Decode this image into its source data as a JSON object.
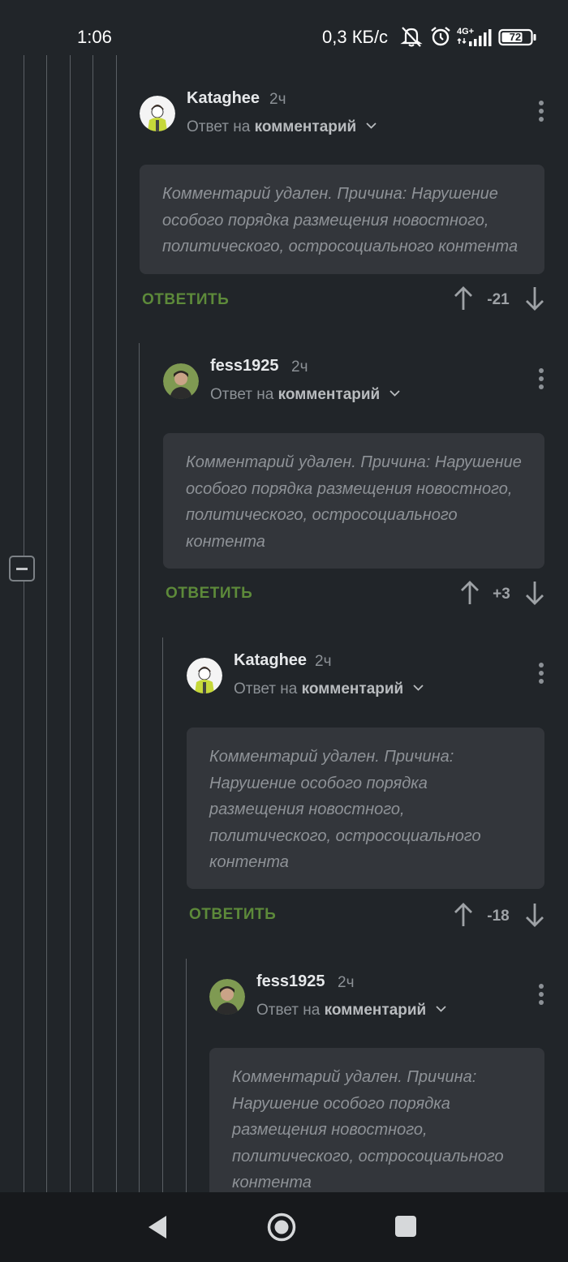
{
  "status_bar": {
    "time": "1:06",
    "net_speed": "0,3 КБ/с",
    "network_type": "4G+",
    "battery": "72",
    "icons": [
      "mute-icon",
      "alarm-icon",
      "signal-icon",
      "battery-icon"
    ]
  },
  "comments": [
    {
      "username": "Kataghee",
      "time": "2ч",
      "reply_prefix": "Ответ на",
      "reply_target": "комментарий",
      "text": "Комментарий удален. Причина: Нарушение особого порядка размещения новостного, политического, остросоциального контента",
      "reply_label": "ОТВЕТИТЬ",
      "score": "-21"
    },
    {
      "username": "fess1925",
      "time": "2ч",
      "reply_prefix": "Ответ на",
      "reply_target": "комментарий",
      "text": "Комментарий удален. Причина: Нарушение особого порядка размещения новостного, политического, остросоциального контента",
      "reply_label": "ОТВЕТИТЬ",
      "score": "+3"
    },
    {
      "username": "Kataghee",
      "time": "2ч",
      "reply_prefix": "Ответ на",
      "reply_target": "комментарий",
      "text": "Комментарий удален. Причина: Нарушение особого порядка размещения новостного, политического, остросоциального контента",
      "reply_label": "ОТВЕТИТЬ",
      "score": "-18"
    },
    {
      "username": "fess1925",
      "time": "2ч",
      "reply_prefix": "Ответ на",
      "reply_target": "комментарий",
      "text": "Комментарий удален. Причина: Нарушение особого порядка размещения новостного, политического, остросоциального контента"
    }
  ],
  "colors": {
    "background": "#212529",
    "card": "#33363b",
    "reply_green": "#5d8a3a",
    "muted_text": "#8c9196"
  },
  "nav_icons": [
    "back-icon",
    "home-icon",
    "recents-icon"
  ]
}
